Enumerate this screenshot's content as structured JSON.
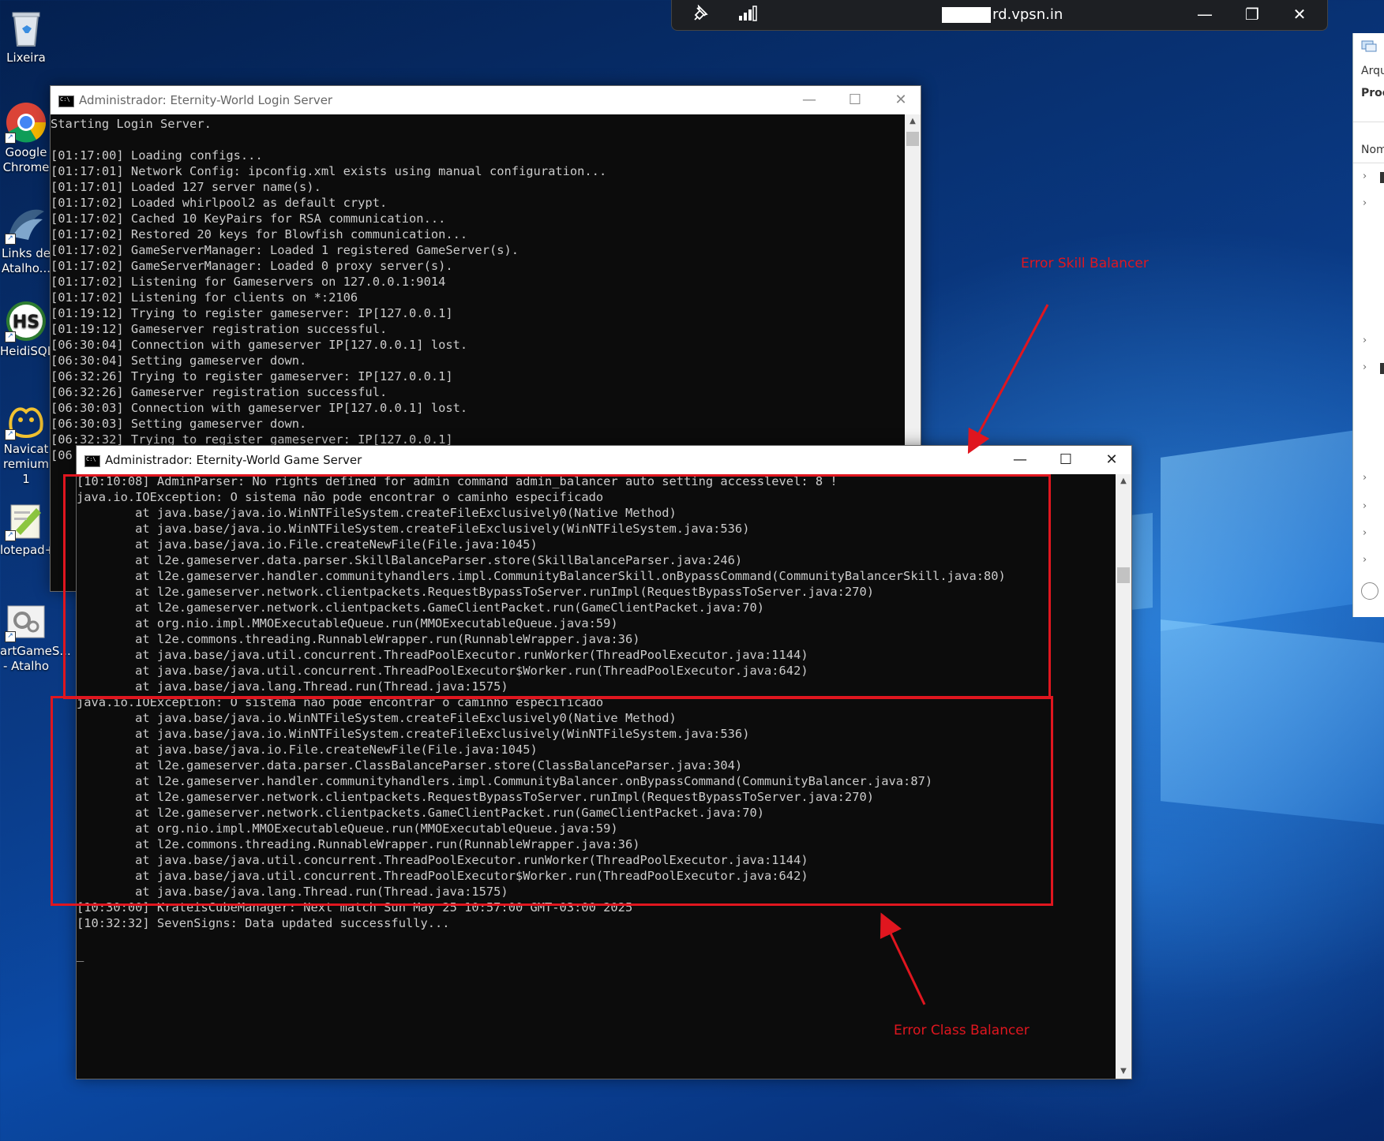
{
  "rdp_bar": {
    "host": "rd.vpsn.in",
    "minimize_glyph": "—",
    "restore_glyph": "❐",
    "close_glyph": "✕",
    "pin_icon": "unpin-icon",
    "signal_icon": "signal-bars-icon"
  },
  "desktop": {
    "icons": [
      {
        "name": "recycle-bin-icon",
        "line1": "Lixeira",
        "line2": ""
      },
      {
        "name": "chrome-icon",
        "line1": "Google",
        "line2": "Chrome"
      },
      {
        "name": "links-folder-icon",
        "line1": "Links de",
        "line2": "Atalho..."
      },
      {
        "name": "heidisql-icon",
        "line1": "HeidiSQL",
        "line2": "",
        "logo": "HS"
      },
      {
        "name": "navicat-icon",
        "line1": "Navicat",
        "line2": "remium 1"
      },
      {
        "name": "notepadpp-icon",
        "line1": "lotepad+",
        "line2": ""
      },
      {
        "name": "startgameserver-icon",
        "line1": "artGameS...",
        "line2": "- Atalho"
      }
    ]
  },
  "explorer_fragment": {
    "labels": [
      "Arqu",
      "Proc",
      "Nom"
    ]
  },
  "login_window": {
    "title": "Administrador:  Eternity-World Login Server",
    "minimize": "—",
    "maximize": "☐",
    "close": "✕",
    "lines": [
      "Starting Login Server.",
      "",
      "[01:17:00] Loading configs...",
      "[01:17:01] Network Config: ipconfig.xml exists using manual configuration...",
      "[01:17:01] Loaded 127 server name(s).",
      "[01:17:02] Loaded whirlpool2 as default crypt.",
      "[01:17:02] Cached 10 KeyPairs for RSA communication...",
      "[01:17:02] Restored 20 keys for Blowfish communication...",
      "[01:17:02] GameServerManager: Loaded 1 registered GameServer(s).",
      "[01:17:02] GameServerManager: Loaded 0 proxy server(s).",
      "[01:17:02] Listening for Gameservers on 127.0.0.1:9014",
      "[01:17:02] Listening for clients on *:2106",
      "[01:19:12] Trying to register gameserver: IP[127.0.0.1]",
      "[01:19:12] Gameserver registration successful.",
      "[06:30:04] Connection with gameserver IP[127.0.0.1] lost.",
      "[06:30:04] Setting gameserver down.",
      "[06:32:26] Trying to register gameserver: IP[127.0.0.1]",
      "[06:32:26] Gameserver registration successful.",
      "[06:30:03] Connection with gameserver IP[127.0.0.1] lost.",
      "[06:30:03] Setting gameserver down.",
      "[06:32:32] Trying to register gameserver: IP[127.0.0.1]",
      "[06"
    ]
  },
  "game_window": {
    "title": "Administrador:  Eternity-World Game Server",
    "minimize": "—",
    "maximize": "☐",
    "close": "✕",
    "lines": [
      "[10:10:08] AdminParser: No rights defined for admin command admin_balancer auto setting accesslevel: 8 !",
      "java.io.IOException: O sistema não pode encontrar o caminho especificado",
      "        at java.base/java.io.WinNTFileSystem.createFileExclusively0(Native Method)",
      "        at java.base/java.io.WinNTFileSystem.createFileExclusively(WinNTFileSystem.java:536)",
      "        at java.base/java.io.File.createNewFile(File.java:1045)",
      "        at l2e.gameserver.data.parser.SkillBalanceParser.store(SkillBalanceParser.java:246)",
      "        at l2e.gameserver.handler.communityhandlers.impl.CommunityBalancerSkill.onBypassCommand(CommunityBalancerSkill.java:80)",
      "        at l2e.gameserver.network.clientpackets.RequestBypassToServer.runImpl(RequestBypassToServer.java:270)",
      "        at l2e.gameserver.network.clientpackets.GameClientPacket.run(GameClientPacket.java:70)",
      "        at org.nio.impl.MMOExecutableQueue.run(MMOExecutableQueue.java:59)",
      "        at l2e.commons.threading.RunnableWrapper.run(RunnableWrapper.java:36)",
      "        at java.base/java.util.concurrent.ThreadPoolExecutor.runWorker(ThreadPoolExecutor.java:1144)",
      "        at java.base/java.util.concurrent.ThreadPoolExecutor$Worker.run(ThreadPoolExecutor.java:642)",
      "        at java.base/java.lang.Thread.run(Thread.java:1575)",
      "java.io.IOException: O sistema não pode encontrar o caminho especificado",
      "        at java.base/java.io.WinNTFileSystem.createFileExclusively0(Native Method)",
      "        at java.base/java.io.WinNTFileSystem.createFileExclusively(WinNTFileSystem.java:536)",
      "        at java.base/java.io.File.createNewFile(File.java:1045)",
      "        at l2e.gameserver.data.parser.ClassBalanceParser.store(ClassBalanceParser.java:304)",
      "        at l2e.gameserver.handler.communityhandlers.impl.CommunityBalancer.onBypassCommand(CommunityBalancer.java:87)",
      "        at l2e.gameserver.network.clientpackets.RequestBypassToServer.runImpl(RequestBypassToServer.java:270)",
      "        at l2e.gameserver.network.clientpackets.GameClientPacket.run(GameClientPacket.java:70)",
      "        at org.nio.impl.MMOExecutableQueue.run(MMOExecutableQueue.java:59)",
      "        at l2e.commons.threading.RunnableWrapper.run(RunnableWrapper.java:36)",
      "        at java.base/java.util.concurrent.ThreadPoolExecutor.runWorker(ThreadPoolExecutor.java:1144)",
      "        at java.base/java.util.concurrent.ThreadPoolExecutor$Worker.run(ThreadPoolExecutor.java:642)",
      "        at java.base/java.lang.Thread.run(Thread.java:1575)",
      "[10:30:00] KrateisCubeManager: Next match Sun May 25 10:57:00 GMT-03:00 2025",
      "[10:32:32] SevenSigns: Data updated successfully..."
    ],
    "cursor": "_"
  },
  "annotations": {
    "skill_error": "Error Skill Balancer",
    "class_error": "Error Class Balancer",
    "color": "#e0161f"
  }
}
